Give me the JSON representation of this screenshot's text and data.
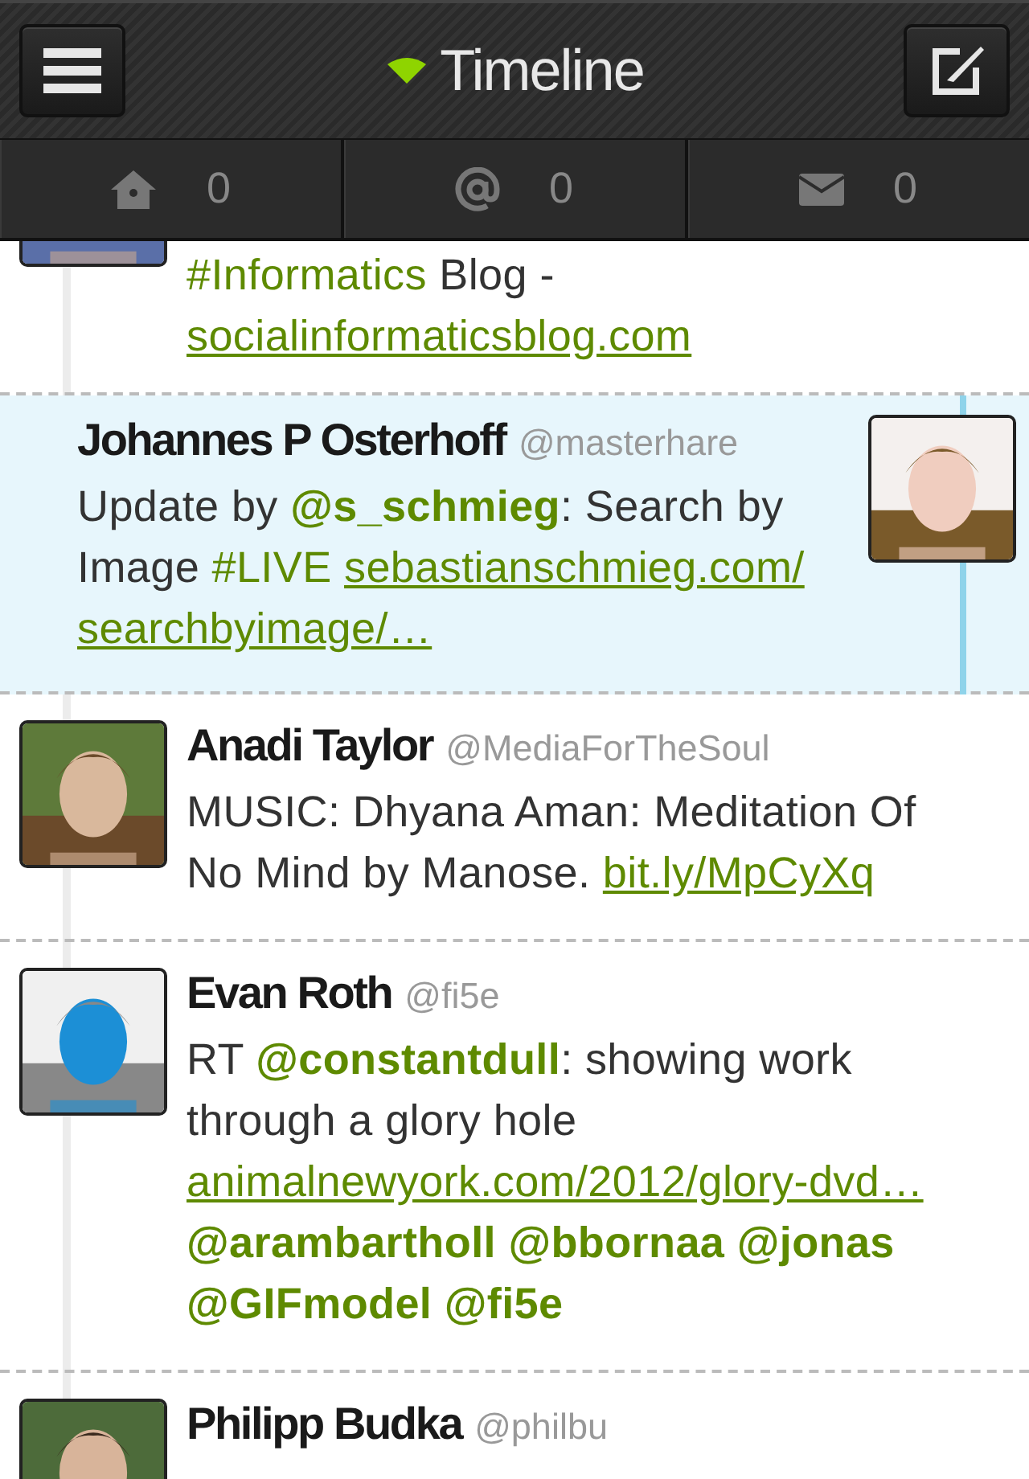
{
  "header": {
    "title": "Timeline"
  },
  "tabs": [
    {
      "kind": "home",
      "count": "0"
    },
    {
      "kind": "mention",
      "count": "0"
    },
    {
      "kind": "mail",
      "count": "0"
    }
  ],
  "tweets": [
    {
      "selected": false,
      "body": [
        {
          "kind": "hashtag",
          "text": "#Informatics"
        },
        {
          "kind": "text",
          "text": " Blog - "
        },
        {
          "kind": "link",
          "text": "socialinformaticsblog.com"
        }
      ]
    },
    {
      "selected": true,
      "name": "Johannes P Osterhoff",
      "handle": "@masterhare",
      "body": [
        {
          "kind": "text",
          "text": "Update by "
        },
        {
          "kind": "mention",
          "text": "@s_schmieg"
        },
        {
          "kind": "text",
          "text": ": Search by Image "
        },
        {
          "kind": "hashtag",
          "text": "#LIVE"
        },
        {
          "kind": "link",
          "text": "sebastianschmieg.com/"
        },
        {
          "kind": "link",
          "text": "searchbyimage/…"
        }
      ]
    },
    {
      "selected": false,
      "name": "Anadi Taylor",
      "handle": "@MediaForTheSoul",
      "body": [
        {
          "kind": "text",
          "text": "MUSIC: Dhyana Aman: Meditation Of No Mind by Manose. "
        },
        {
          "kind": "link",
          "text": "bit.ly/MpCyXq"
        }
      ]
    },
    {
      "selected": false,
      "name": "Evan Roth",
      "handle": "@fi5e",
      "body": [
        {
          "kind": "text",
          "text": "RT "
        },
        {
          "kind": "mention",
          "text": "@constantdull"
        },
        {
          "kind": "text",
          "text": ": showing work through a glory hole "
        },
        {
          "kind": "link",
          "text": "animalnewyork.com/2012/glory-dvd…"
        },
        {
          "kind": "mention",
          "text": "@arambartholl"
        },
        {
          "kind": "mention",
          "text": "@bbornaa"
        },
        {
          "kind": "mention",
          "text": "@jonas"
        },
        {
          "kind": "mention",
          "text": "@GIFmodel"
        },
        {
          "kind": "mention",
          "text": "@fi5e"
        }
      ]
    },
    {
      "selected": false,
      "name": "Philipp Budka",
      "handle": "@philbu"
    }
  ]
}
